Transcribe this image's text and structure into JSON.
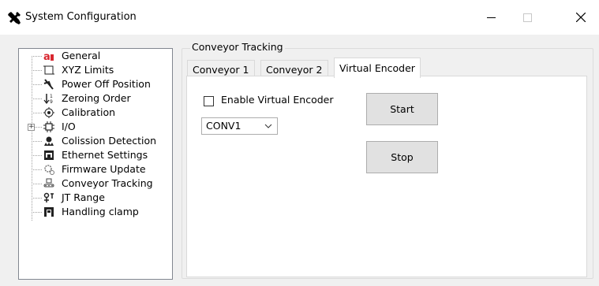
{
  "window": {
    "title": "System Configuration",
    "app_icon": "tools-icon",
    "controls": [
      "minimize-icon",
      "maximize-icon",
      "close-icon"
    ]
  },
  "tree": {
    "items": [
      {
        "label": "General",
        "icon": "general-icon"
      },
      {
        "label": "XYZ Limits",
        "icon": "xyz-limits-icon"
      },
      {
        "label": "Power Off Position",
        "icon": "power-off-position-icon"
      },
      {
        "label": "Zeroing Order",
        "icon": "zeroing-order-icon"
      },
      {
        "label": "Calibration",
        "icon": "calibration-icon"
      },
      {
        "label": "I/O",
        "icon": "io-icon",
        "expandable": true
      },
      {
        "label": "Colission Detection",
        "icon": "collision-detection-icon"
      },
      {
        "label": "Ethernet Settings",
        "icon": "ethernet-settings-icon"
      },
      {
        "label": "Firmware Update",
        "icon": "firmware-update-icon"
      },
      {
        "label": "Conveyor Tracking",
        "icon": "conveyor-tracking-icon"
      },
      {
        "label": "JT Range",
        "icon": "jt-range-icon"
      },
      {
        "label": "Handling clamp",
        "icon": "handling-clamp-icon"
      }
    ]
  },
  "group": {
    "label": "Conveyor Tracking",
    "tabs": [
      {
        "label": "Conveyor 1"
      },
      {
        "label": "Conveyor 2"
      },
      {
        "label": "Virtual Encoder",
        "active": true
      }
    ]
  },
  "panel": {
    "enable_label": "Enable Virtual Encoder",
    "enable_checked": false,
    "combo_value": "CONV1",
    "start_label": "Start",
    "stop_label": "Stop"
  },
  "colors": {
    "window_bg": "#f0f0f0",
    "accent_red": "#d8262f",
    "border": "#adadad"
  }
}
